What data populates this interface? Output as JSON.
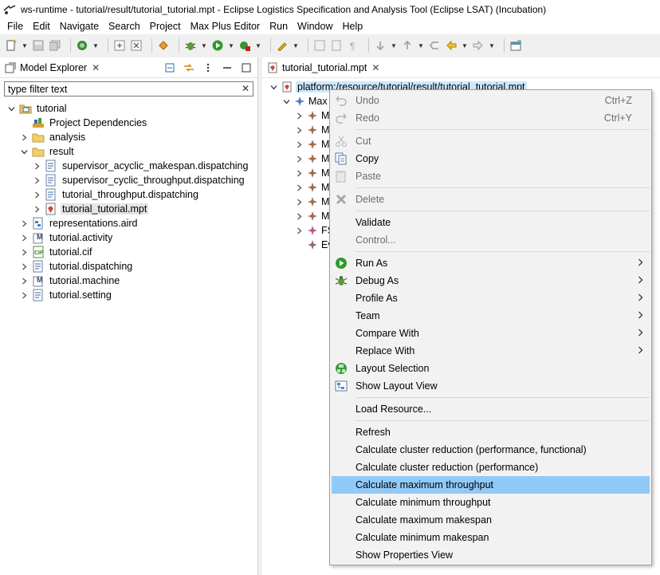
{
  "window": {
    "title": "ws-runtime - tutorial/result/tutorial_tutorial.mpt - Eclipse Logistics Specification and Analysis Tool (Eclipse LSAT) (Incubation)"
  },
  "menu": [
    "File",
    "Edit",
    "Navigate",
    "Search",
    "Project",
    "Max Plus Editor",
    "Run",
    "Window",
    "Help"
  ],
  "explorer": {
    "tab_label": "Model Explorer",
    "filter_value": "type filter text",
    "tree": [
      {
        "label": "tutorial",
        "level": 0,
        "toggle": "expanded",
        "icon": "project-icon"
      },
      {
        "label": "Project Dependencies",
        "level": 1,
        "toggle": "none",
        "icon": "library-icon"
      },
      {
        "label": "analysis",
        "level": 1,
        "toggle": "collapsed",
        "icon": "folder-icon"
      },
      {
        "label": "result",
        "level": 1,
        "toggle": "expanded",
        "icon": "folder-icon"
      },
      {
        "label": "supervisor_acyclic_makespan.dispatching",
        "level": 2,
        "toggle": "collapsed",
        "icon": "dispatching-file-icon"
      },
      {
        "label": "supervisor_cyclic_throughput.dispatching",
        "level": 2,
        "toggle": "collapsed",
        "icon": "dispatching-file-icon"
      },
      {
        "label": "tutorial_throughput.dispatching",
        "level": 2,
        "toggle": "collapsed",
        "icon": "dispatching-file-icon"
      },
      {
        "label": "tutorial_tutorial.mpt",
        "level": 2,
        "toggle": "collapsed",
        "icon": "mpt-file-icon",
        "selected": true
      },
      {
        "label": "representations.aird",
        "level": 1,
        "toggle": "collapsed",
        "icon": "aird-file-icon"
      },
      {
        "label": "tutorial.activity",
        "level": 1,
        "toggle": "collapsed",
        "icon": "activity-file-icon"
      },
      {
        "label": "tutorial.cif",
        "level": 1,
        "toggle": "collapsed",
        "icon": "cif-file-icon"
      },
      {
        "label": "tutorial.dispatching",
        "level": 1,
        "toggle": "collapsed",
        "icon": "dispatching-file-icon"
      },
      {
        "label": "tutorial.machine",
        "level": 1,
        "toggle": "collapsed",
        "icon": "machine-file-icon"
      },
      {
        "label": "tutorial.setting",
        "level": 1,
        "toggle": "collapsed",
        "icon": "setting-file-icon"
      }
    ]
  },
  "editor": {
    "tab_label": "tutorial_tutorial.mpt",
    "root_label": "platform:/resource/tutorial/result/tutorial_tutorial.mpt",
    "rows": [
      {
        "label": "Max",
        "level": 1,
        "toggle": "expanded",
        "icon": "maxplus-node-icon"
      },
      {
        "label": "M",
        "level": 2,
        "toggle": "collapsed",
        "icon": "matrix-node-icon"
      },
      {
        "label": "M",
        "level": 2,
        "toggle": "collapsed",
        "icon": "matrix-node-icon"
      },
      {
        "label": "M",
        "level": 2,
        "toggle": "collapsed",
        "icon": "matrix-node-icon"
      },
      {
        "label": "M",
        "level": 2,
        "toggle": "collapsed",
        "icon": "matrix-node-icon"
      },
      {
        "label": "M",
        "level": 2,
        "toggle": "collapsed",
        "icon": "matrix-node-icon"
      },
      {
        "label": "M",
        "level": 2,
        "toggle": "collapsed",
        "icon": "matrix-node-icon"
      },
      {
        "label": "M",
        "level": 2,
        "toggle": "collapsed",
        "icon": "matrix-node-icon"
      },
      {
        "label": "M",
        "level": 2,
        "toggle": "collapsed",
        "icon": "matrix-node-icon"
      },
      {
        "label": "FS",
        "level": 2,
        "toggle": "collapsed",
        "icon": "fsm-node-icon"
      },
      {
        "label": "Ev",
        "level": 2,
        "toggle": "none",
        "icon": "event-node-icon"
      }
    ]
  },
  "context_menu": {
    "items": [
      {
        "label": "Undo",
        "shortcut": "Ctrl+Z",
        "disabled": true,
        "icon": "undo-icon"
      },
      {
        "label": "Redo",
        "shortcut": "Ctrl+Y",
        "disabled": true,
        "icon": "redo-icon"
      },
      {
        "separator": true
      },
      {
        "label": "Cut",
        "disabled": true,
        "icon": "cut-icon"
      },
      {
        "label": "Copy",
        "icon": "copy-icon"
      },
      {
        "label": "Paste",
        "disabled": true,
        "icon": "paste-icon"
      },
      {
        "separator": true
      },
      {
        "label": "Delete",
        "disabled": true,
        "icon": "delete-icon"
      },
      {
        "separator": true
      },
      {
        "label": "Validate"
      },
      {
        "label": "Control...",
        "disabled": true
      },
      {
        "separator": true
      },
      {
        "label": "Run As",
        "submenu": true,
        "icon": "run-icon"
      },
      {
        "label": "Debug As",
        "submenu": true,
        "icon": "debug-icon"
      },
      {
        "label": "Profile As",
        "submenu": true
      },
      {
        "label": "Team",
        "submenu": true
      },
      {
        "label": "Compare With",
        "submenu": true
      },
      {
        "label": "Replace With",
        "submenu": true
      },
      {
        "label": "Layout Selection",
        "icon": "layout-selection-icon"
      },
      {
        "label": "Show Layout View",
        "icon": "layout-view-icon"
      },
      {
        "separator": true
      },
      {
        "label": "Load Resource..."
      },
      {
        "separator": true
      },
      {
        "label": "Refresh"
      },
      {
        "label": "Calculate cluster reduction (performance, functional)"
      },
      {
        "label": "Calculate cluster reduction (performance)"
      },
      {
        "label": "Calculate maximum throughput",
        "highlighted": true
      },
      {
        "label": "Calculate minimum throughput"
      },
      {
        "label": "Calculate maximum makespan"
      },
      {
        "label": "Calculate minimum makespan"
      },
      {
        "label": "Show Properties View"
      }
    ]
  },
  "colors": {
    "selection_blue": "#cce8ff",
    "menu_highlight": "#91c9f7",
    "menu_bg": "#f2f2f2"
  }
}
